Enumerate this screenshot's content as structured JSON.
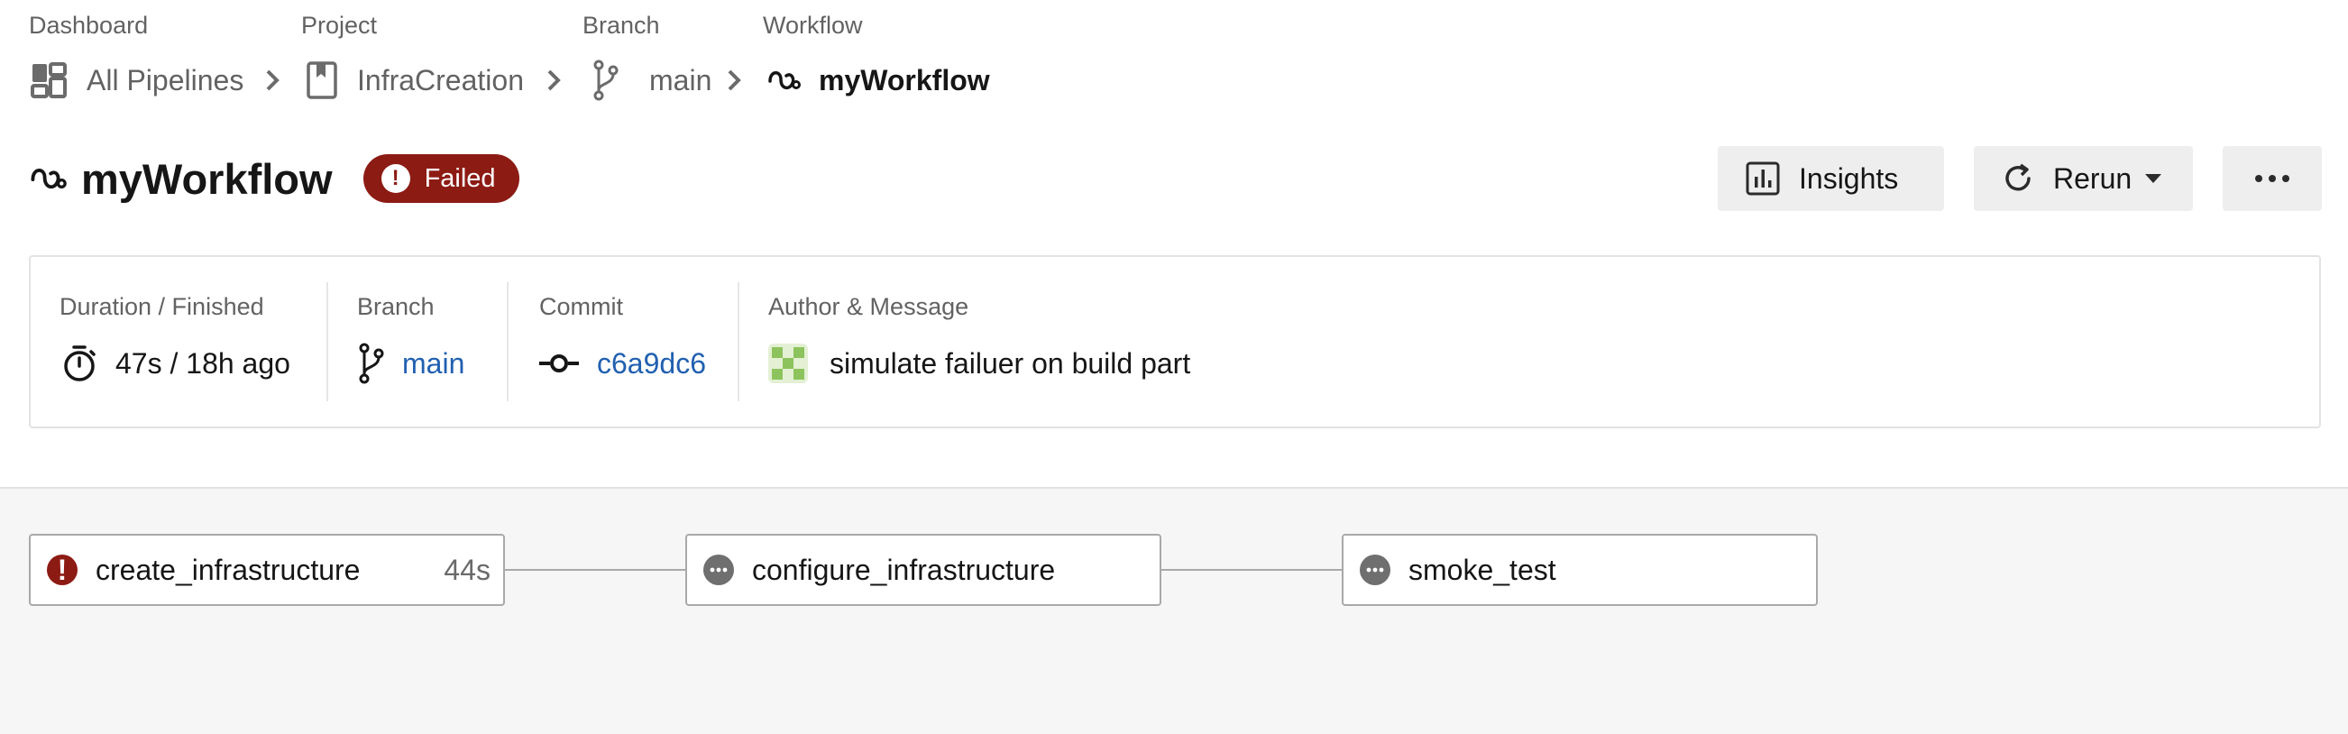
{
  "breadcrumb": {
    "dashboard": {
      "caption": "Dashboard",
      "label": "All Pipelines"
    },
    "project": {
      "caption": "Project",
      "label": "InfraCreation"
    },
    "branch": {
      "caption": "Branch",
      "label": "main"
    },
    "workflow": {
      "caption": "Workflow",
      "label": "myWorkflow"
    }
  },
  "header": {
    "title": "myWorkflow",
    "status": "Failed",
    "status_color": "#8c1b14",
    "insights_label": "Insights",
    "rerun_label": "Rerun"
  },
  "summary": {
    "duration": {
      "label": "Duration / Finished",
      "value": "47s / 18h ago"
    },
    "branch": {
      "label": "Branch",
      "value": "main"
    },
    "commit": {
      "label": "Commit",
      "value": "c6a9dc6"
    },
    "author": {
      "label": "Author & Message",
      "message": "simulate failuer on build part"
    },
    "link_color": "#2160b0"
  },
  "jobs": [
    {
      "name": "create_infrastructure",
      "duration": "44s",
      "status": "failed",
      "icon": "error-icon"
    },
    {
      "name": "configure_infrastructure",
      "duration": "",
      "status": "pending",
      "icon": "more-horizontal-icon"
    },
    {
      "name": "smoke_test",
      "duration": "",
      "status": "pending",
      "icon": "more-horizontal-icon"
    }
  ]
}
